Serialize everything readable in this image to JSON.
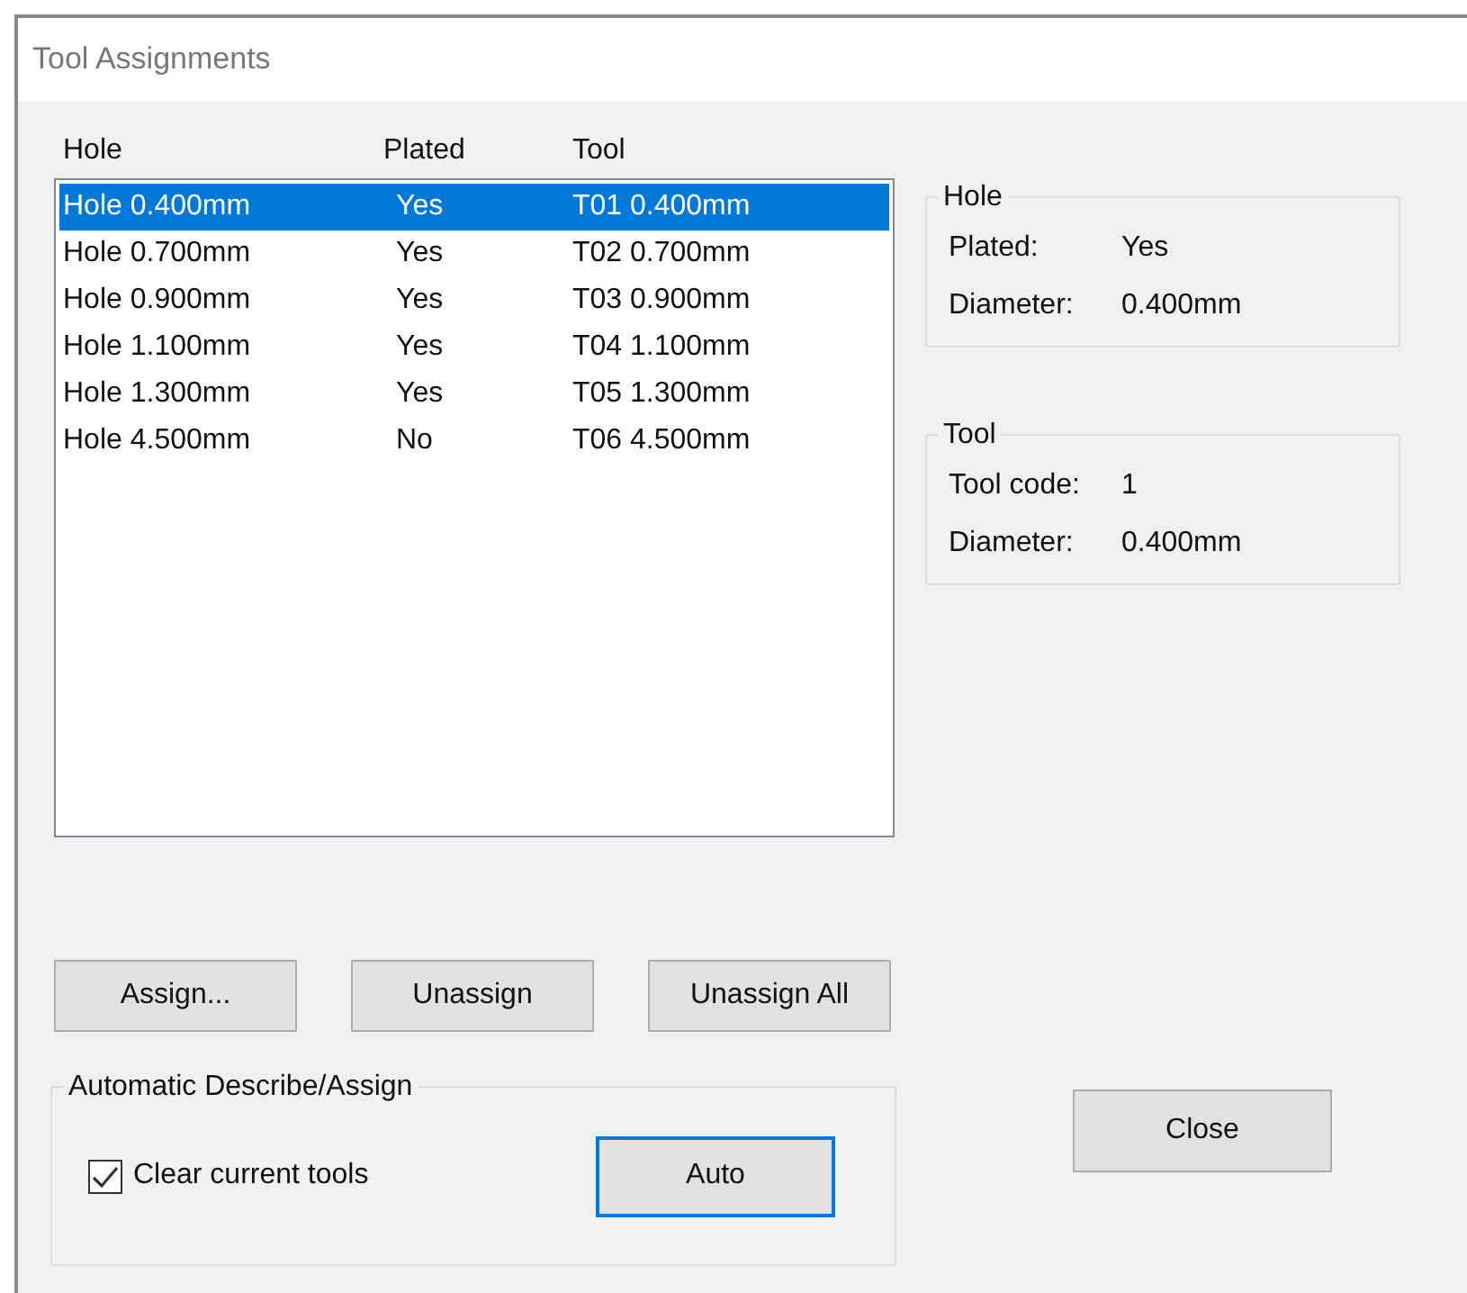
{
  "window": {
    "title": "Tool Assignments"
  },
  "list": {
    "columns": [
      "Hole",
      "Plated",
      "Tool"
    ],
    "rows": [
      {
        "hole": "Hole 0.400mm",
        "plated": "Yes",
        "tool": "T01 0.400mm",
        "selected": true
      },
      {
        "hole": "Hole 0.700mm",
        "plated": "Yes",
        "tool": "T02 0.700mm",
        "selected": false
      },
      {
        "hole": "Hole 0.900mm",
        "plated": "Yes",
        "tool": "T03 0.900mm",
        "selected": false
      },
      {
        "hole": "Hole 1.100mm",
        "plated": "Yes",
        "tool": "T04 1.100mm",
        "selected": false
      },
      {
        "hole": "Hole 1.300mm",
        "plated": "Yes",
        "tool": "T05 1.300mm",
        "selected": false
      },
      {
        "hole": "Hole 4.500mm",
        "plated": "No",
        "tool": "T06 4.500mm",
        "selected": false
      }
    ]
  },
  "hole_group": {
    "title": "Hole",
    "fields": [
      {
        "label": "Plated:",
        "value": "Yes"
      },
      {
        "label": "Diameter:",
        "value": "0.400mm"
      }
    ]
  },
  "tool_group": {
    "title": "Tool",
    "fields": [
      {
        "label": "Tool code:",
        "value": "1"
      },
      {
        "label": "Diameter:",
        "value": "0.400mm"
      }
    ]
  },
  "buttons": [
    "Assign...",
    "Unassign",
    "Unassign All"
  ],
  "auto_group": {
    "title": "Automatic Describe/Assign",
    "checkbox": {
      "label": "Clear current tools",
      "checked": true
    },
    "button": {
      "label": "Auto",
      "focused": true
    }
  },
  "close_button": "Close"
}
